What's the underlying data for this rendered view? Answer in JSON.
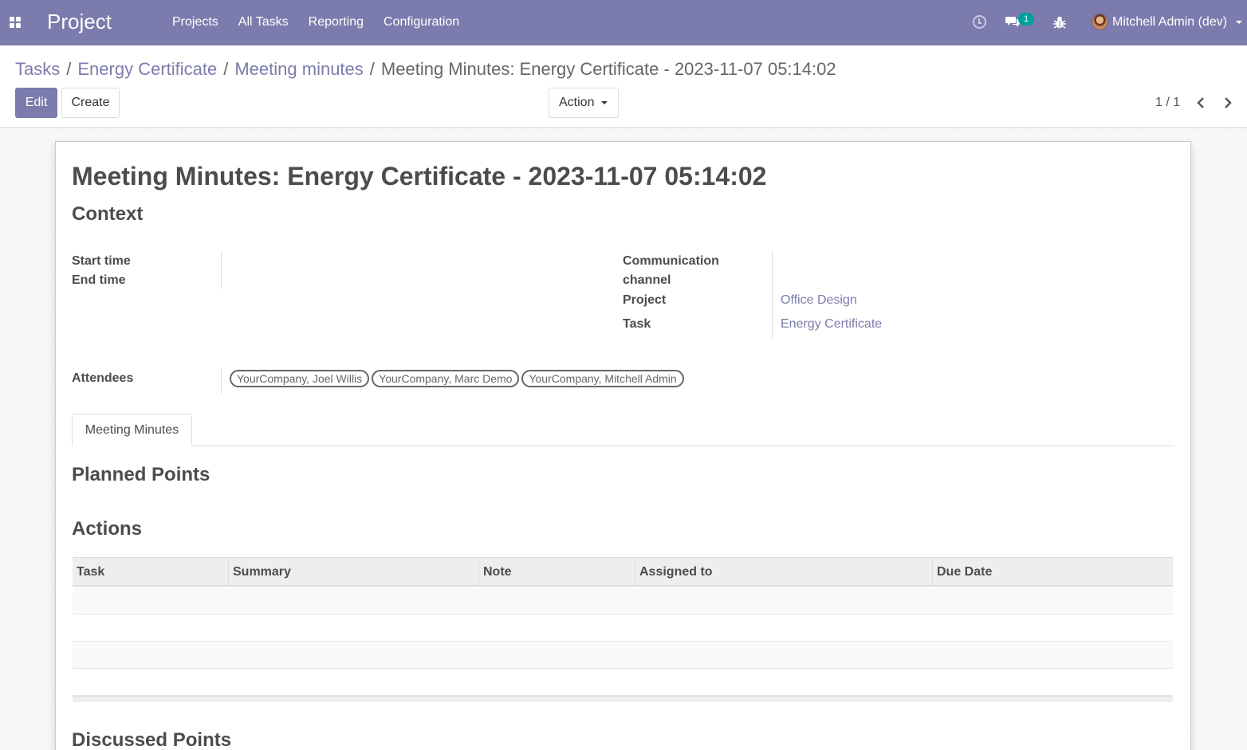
{
  "navbar": {
    "brand": "Project",
    "menu": [
      "Projects",
      "All Tasks",
      "Reporting",
      "Configuration"
    ],
    "chat_count": "1",
    "user_name": "Mitchell Admin (dev)",
    "color": "#7c7bad"
  },
  "breadcrumb": {
    "items": [
      "Tasks",
      "Energy Certificate",
      "Meeting minutes"
    ],
    "separator": "/",
    "current": "Meeting Minutes: Energy Certificate - 2023-11-07 05:14:02"
  },
  "buttons": {
    "edit": "Edit",
    "create": "Create",
    "action": "Action"
  },
  "pager": {
    "value": "1 / 1"
  },
  "form": {
    "title": "Meeting Minutes: Energy Certificate - 2023-11-07 05:14:02",
    "context_heading": "Context",
    "fields": {
      "start_time_label": "Start time",
      "end_time_label": "End time",
      "channel_label_line1": "Communication",
      "channel_label_line2": "channel",
      "project_label": "Project",
      "project_value": "Office Design",
      "task_label": "Task",
      "task_value": "Energy Certificate",
      "attendees_label": "Attendees",
      "attendees": [
        "YourCompany, Joel Willis",
        "YourCompany, Marc Demo",
        "YourCompany, Mitchell Admin"
      ]
    },
    "tab": "Meeting Minutes",
    "planned_heading": "Planned Points",
    "actions_heading": "Actions",
    "actions_table": {
      "columns": [
        "Task",
        "Summary",
        "Note",
        "Assigned to",
        "Due Date"
      ],
      "rows": []
    },
    "discussed_heading": "Discussed Points"
  }
}
